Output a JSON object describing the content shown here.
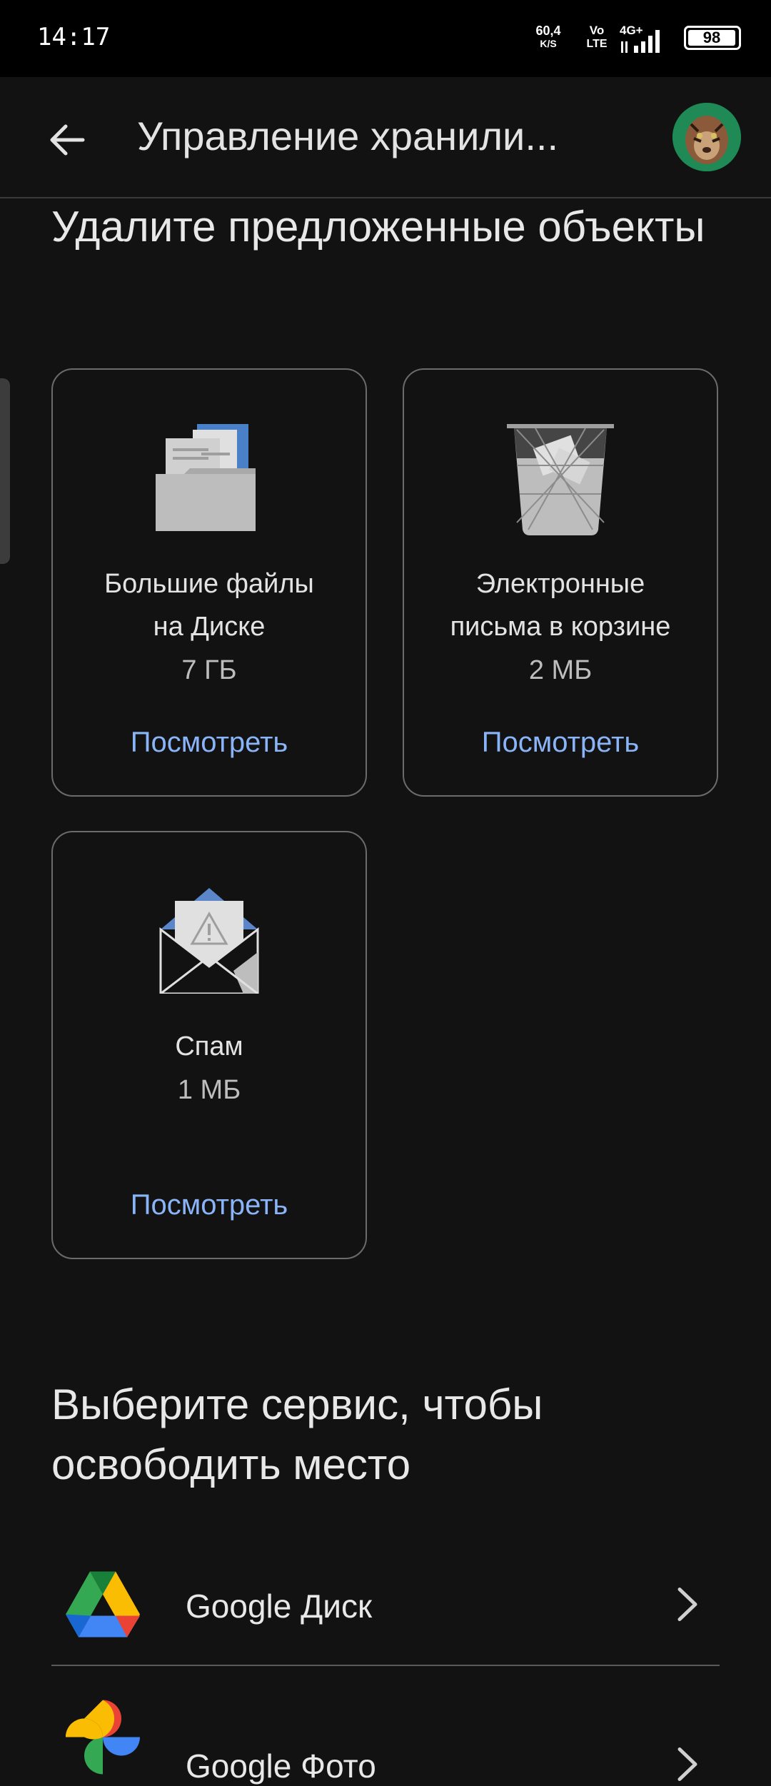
{
  "status_bar": {
    "time": "14:17",
    "net_speed_value": "60,4",
    "net_speed_unit": "K/S",
    "volte_top": "Vo",
    "volte_bottom": "LTE",
    "network": "4G+",
    "battery": "98"
  },
  "app_bar": {
    "title": "Управление хранили...",
    "back_icon": "arrow-back-icon",
    "avatar_icon": "profile-avatar"
  },
  "suggested": {
    "title": "Удалите предложенные объекты",
    "cards": [
      {
        "title_line1": "Большие файлы",
        "title_line2": "на Диске",
        "size": "7 ГБ",
        "action": "Посмотреть",
        "icon": "folder-files-icon"
      },
      {
        "title_line1": "Электронные",
        "title_line2": "письма в корзине",
        "size": "2 МБ",
        "action": "Посмотреть",
        "icon": "trash-bin-icon"
      },
      {
        "title_line1": "Спам",
        "size": "1 МБ",
        "action": "Посмотреть",
        "icon": "spam-envelope-icon"
      }
    ]
  },
  "services": {
    "title": "Выберите сервис, чтобы освободить место",
    "items": [
      {
        "label": "Google Диск",
        "icon": "google-drive-icon"
      },
      {
        "label": "Google Фото",
        "icon": "google-photos-icon"
      }
    ]
  },
  "colors": {
    "background": "#121212",
    "link": "#8ab4f8",
    "card_border": "#6b6b6b"
  }
}
